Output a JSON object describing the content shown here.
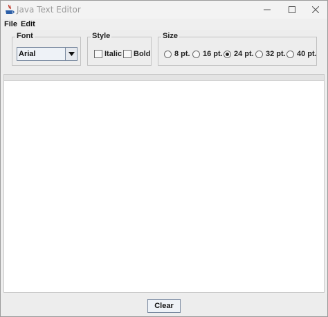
{
  "window": {
    "title": "Java Text Editor"
  },
  "menubar": {
    "items": [
      {
        "label": "File"
      },
      {
        "label": "Edit"
      }
    ]
  },
  "toolbar": {
    "font_group": {
      "legend": "Font",
      "selected": "Arial"
    },
    "style_group": {
      "legend": "Style",
      "options": [
        {
          "label": "Italic",
          "checked": false
        },
        {
          "label": "Bold",
          "checked": false
        }
      ]
    },
    "size_group": {
      "legend": "Size",
      "options": [
        {
          "label": "8 pt.",
          "selected": false
        },
        {
          "label": "16 pt.",
          "selected": false
        },
        {
          "label": "24 pt.",
          "selected": true
        },
        {
          "label": "32 pt.",
          "selected": false
        },
        {
          "label": "40 pt.",
          "selected": false
        }
      ]
    }
  },
  "editor": {
    "text": ""
  },
  "bottom": {
    "clear_label": "Clear"
  }
}
